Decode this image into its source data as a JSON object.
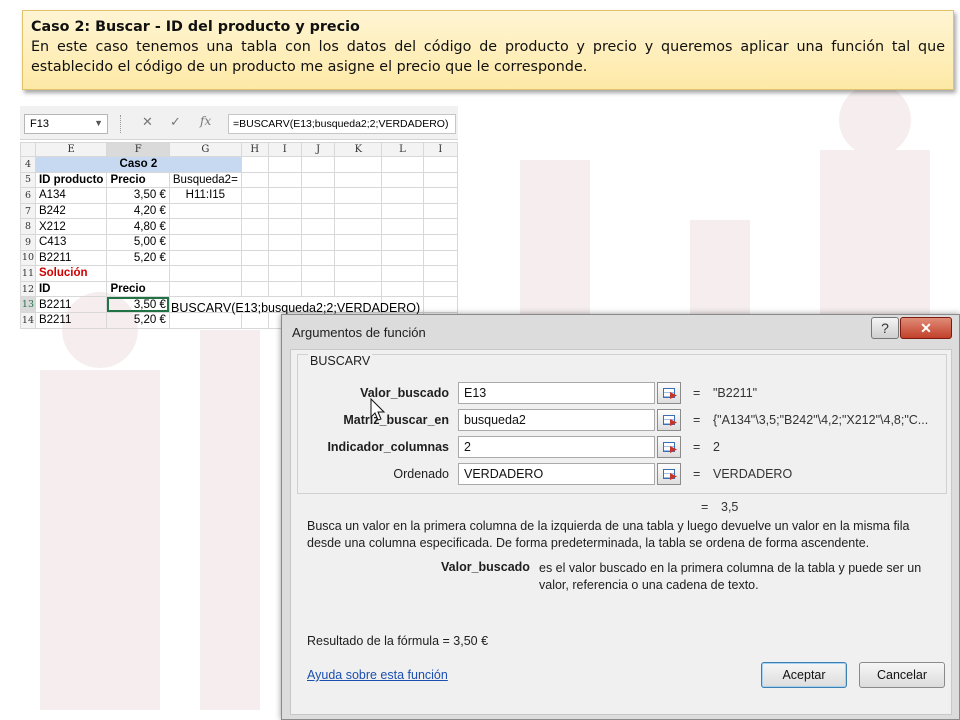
{
  "note": {
    "title": "Caso 2: Buscar -  ID del producto y precio",
    "body": "En este caso tenemos una tabla con los datos del código de producto y precio y queremos aplicar una función tal que establecido el código de un producto me asigne el precio que le corresponde."
  },
  "excel": {
    "name_box": "F13",
    "formula": "=BUSCARV(E13;busqueda2;2;VERDADERO)",
    "columns": [
      "E",
      "F",
      "G",
      "H",
      "I",
      "J",
      "K",
      "L",
      "I"
    ],
    "rows": {
      "r4": {
        "num": "4",
        "caso": "Caso 2"
      },
      "r5": {
        "num": "5",
        "e": "ID producto",
        "f": "Precio",
        "g": "Busqueda2="
      },
      "r6": {
        "num": "6",
        "e": "A134",
        "f": "3,50 €",
        "g": "H11:I15"
      },
      "r7": {
        "num": "7",
        "e": "B242",
        "f": "4,20 €"
      },
      "r8": {
        "num": "8",
        "e": "X212",
        "f": "4,80 €"
      },
      "r9": {
        "num": "9",
        "e": "C413",
        "f": "5,00 €"
      },
      "r10": {
        "num": "10",
        "e": "B2211",
        "f": "5,20 €"
      },
      "r11": {
        "num": "11",
        "e": "Solución"
      },
      "r12": {
        "num": "12",
        "e": "ID",
        "f": "Precio"
      },
      "r13": {
        "num": "13",
        "e": "B2211",
        "f": "3,50 €",
        "g_overflow": "BUSCARV(E13;busqueda2;2;VERDADERO)"
      },
      "r14": {
        "num": "14",
        "e": "B2211",
        "f": "5,20 €"
      }
    }
  },
  "dialog": {
    "title": "Argumentos de función",
    "help_button": "?",
    "close_button": "✕",
    "function_name": "BUSCARV",
    "args": [
      {
        "label": "Valor_buscado",
        "value": "E13",
        "result": "\"B2211\""
      },
      {
        "label": "Matriz_buscar_en",
        "value": "busqueda2",
        "result": "{\"A134\"\\3,5;\"B242\"\\4,2;\"X212\"\\4,8;\"C..."
      },
      {
        "label": "Indicador_columnas",
        "value": "2",
        "result": "2"
      },
      {
        "label": "Ordenado",
        "value": "VERDADERO",
        "result": "VERDADERO"
      }
    ],
    "equals": "=",
    "function_result": "3,5",
    "description": "Busca un valor en la primera columna de la izquierda de una tabla y luego devuelve un valor en la misma fila desde una columna especificada. De forma predeterminada, la tabla se ordena de forma ascendente.",
    "arg_help_name": "Valor_buscado",
    "arg_help_text": "es el valor buscado en la primera columna de la tabla y puede ser un valor, referencia o una cadena de texto.",
    "formula_result": "Resultado de la fórmula =   3,50 €",
    "help_link": "Ayuda sobre esta función",
    "ok_button": "Aceptar",
    "cancel_button": "Cancelar"
  }
}
